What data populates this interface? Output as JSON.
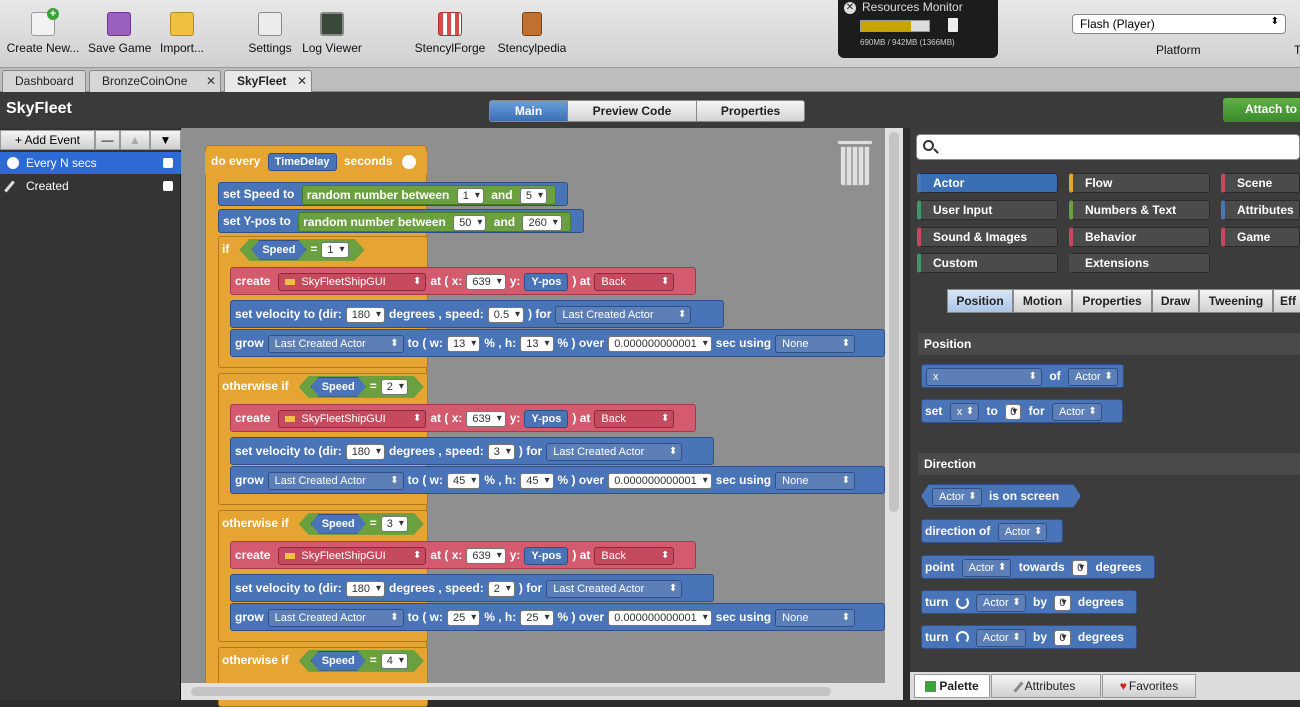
{
  "toolbar": {
    "create_new": "Create New...",
    "save_game": "Save Game",
    "import": "Import...",
    "settings": "Settings",
    "log_viewer": "Log Viewer",
    "stencylforge": "StencylForge",
    "stencylpedia": "Stencylpedia",
    "resources_monitor": {
      "title": "Resources Monitor",
      "memory_text": "690MB / 942MB (1366MB)",
      "usage_fraction": 0.73
    },
    "platform_value": "Flash (Player)",
    "platform_label": "Platform",
    "right_edge_label": "T"
  },
  "tabs": [
    {
      "label": "Dashboard"
    },
    {
      "label": "BronzeCoinOne"
    },
    {
      "label": "SkyFleet"
    }
  ],
  "page_title": "SkyFleet",
  "view_tabs": {
    "main": "Main",
    "preview": "Preview Code",
    "properties": "Properties"
  },
  "attach_button": "Attach to",
  "events": {
    "add_label": "+ Add Event",
    "items": [
      {
        "label": "Every N secs"
      },
      {
        "label": "Created"
      }
    ]
  },
  "code": {
    "do_every": "do every",
    "time_delay": "TimeDelay",
    "seconds": "seconds",
    "set_speed": "set Speed to",
    "set_ypos": "set Y-pos to",
    "random_between": "random number between",
    "and": "and",
    "speed_min": "1",
    "speed_max": "5",
    "y_min": "50",
    "y_max": "260",
    "if": "if",
    "otherwise_if": "otherwise if",
    "speed_var": "Speed",
    "eq": "=",
    "create": "create",
    "actor_type": "SkyFleetShipGUI",
    "at_x": "at ( x:",
    "y": "y:",
    "ypos_var": "Y-pos",
    "at": ") at",
    "layer": "Back",
    "x_value": "639",
    "set_velocity": "set velocity to (dir:",
    "dir": "180",
    "degrees_speed": "degrees , speed:",
    "for": ") for",
    "last_created": "Last Created Actor",
    "grow": "grow",
    "to_w": "to ( w:",
    "pct_h": "% , h:",
    "pct_over": "% ) over",
    "duration": "0.000000000001",
    "sec_using": "sec using",
    "easing": "None",
    "branches": [
      {
        "cond": "1",
        "speed": "0.5",
        "size": "13"
      },
      {
        "cond": "2",
        "speed": "3",
        "size": "45"
      },
      {
        "cond": "3",
        "speed": "2",
        "size": "25"
      },
      {
        "cond": "4"
      }
    ]
  },
  "palette": {
    "search_placeholder": "",
    "categories": [
      {
        "label": "Actor",
        "color": "#4a74b8"
      },
      {
        "label": "Flow",
        "color": "#e6a532"
      },
      {
        "label": "Scene",
        "color": "#c64a5e"
      },
      {
        "label": "User Input",
        "color": "#3c9a6a"
      },
      {
        "label": "Numbers & Text",
        "color": "#6aa040"
      },
      {
        "label": "Attributes",
        "color": "#4a74b8"
      },
      {
        "label": "Sound & Images",
        "color": "#c64a5e"
      },
      {
        "label": "Behavior",
        "color": "#c64a5e"
      },
      {
        "label": "Game",
        "color": "#c64a5e"
      },
      {
        "label": "Custom",
        "color": "#3c9a6a"
      },
      {
        "label": "Extensions",
        "color": "#4b4b4b"
      }
    ],
    "subtabs": [
      "Position",
      "Motion",
      "Properties",
      "Draw",
      "Tweening",
      "Eff"
    ],
    "position_header": "Position",
    "x_field": "x",
    "of": "of",
    "actor": "Actor",
    "set": "set",
    "to": "to",
    "zero": "0",
    "for": "for",
    "direction_header": "Direction",
    "is_on_screen": "is on screen",
    "direction_of": "direction of",
    "point": "point",
    "towards": "towards",
    "degrees": "degrees",
    "turn": "turn",
    "by": "by"
  },
  "bottom_tabs": [
    "Palette",
    "Attributes",
    "Favorites"
  ]
}
